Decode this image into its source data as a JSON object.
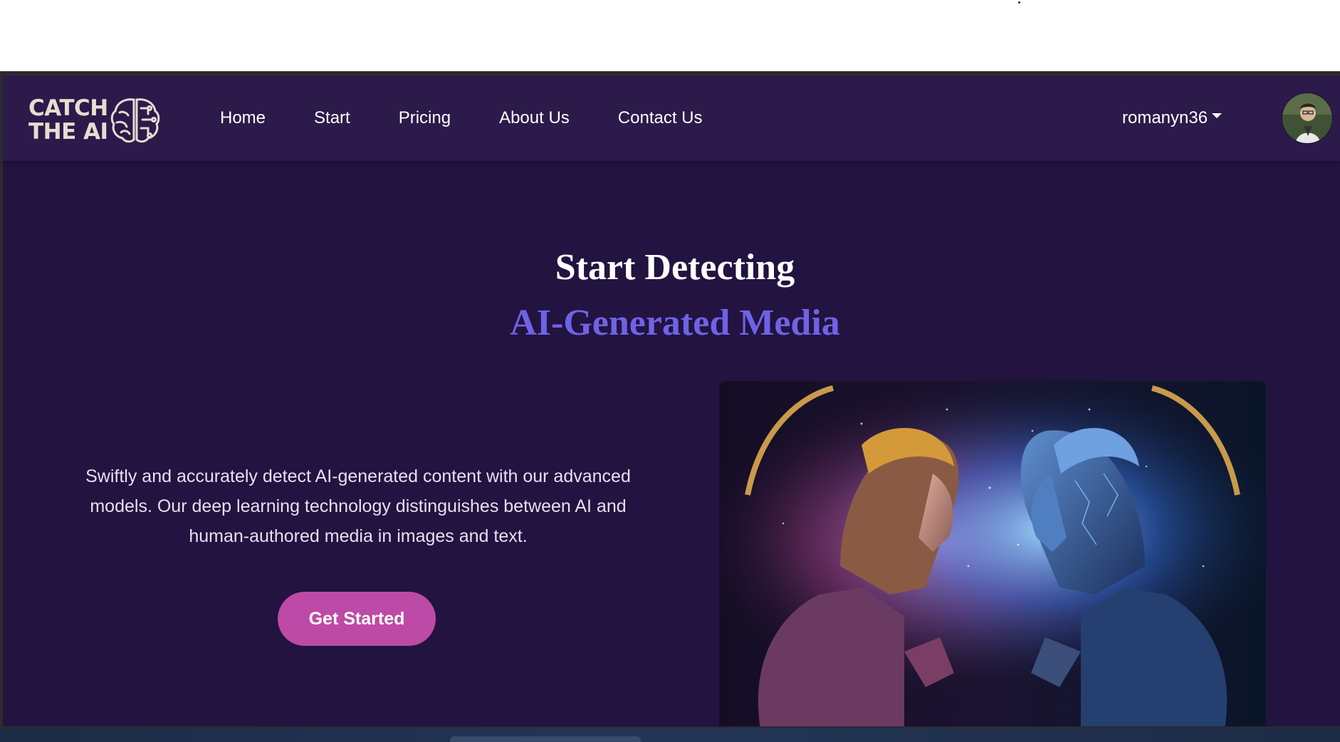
{
  "navbar": {
    "logo": {
      "line1": "CATCH",
      "line2": "THE AI",
      "icon": "brain-icon"
    },
    "links": [
      "Home",
      "Start",
      "Pricing",
      "About Us",
      "Contact Us"
    ],
    "user": {
      "username": "romanyn36",
      "caret_icon": "caret-down-icon",
      "avatar": "user-avatar"
    }
  },
  "hero": {
    "title": "Start Detecting",
    "subtitle": "AI-Generated Media",
    "description": "Swiftly and accurately detect AI-generated content with our advanced models. Our deep learning technology distinguishes between AI and human-authored media in images and text.",
    "cta_label": "Get Started"
  },
  "colors": {
    "page_bg": "#221340",
    "navbar_bg": "#2c1a4b",
    "accent_purple": "#6e63e6",
    "cta_pink": "#bd4aa6",
    "logo_beige": "#e9dcd0"
  }
}
